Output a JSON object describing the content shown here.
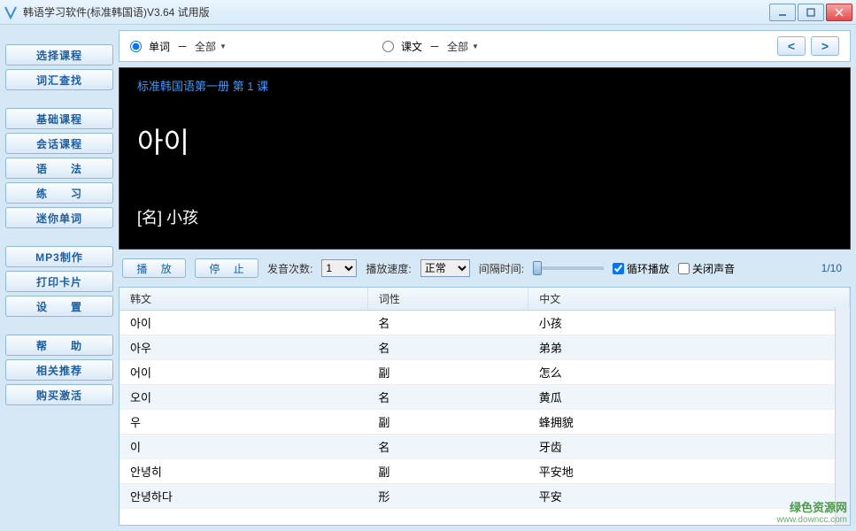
{
  "window": {
    "title": "韩语学习软件(标准韩国语)V3.64 试用版"
  },
  "sidebar": {
    "groups": [
      {
        "items": [
          "选择课程",
          "词汇查找"
        ]
      },
      {
        "items": [
          "基础课程",
          "会话课程",
          "语　　法",
          "练　　习",
          "迷你单词"
        ]
      },
      {
        "items": [
          "MP3制作",
          "打印卡片",
          "设　　置"
        ]
      },
      {
        "items": [
          "帮　　助",
          "相关推荐",
          "购买激活"
        ]
      }
    ]
  },
  "filter": {
    "word_radio": "单词",
    "lesson_radio": "课文",
    "all_dropdown": "全部",
    "dash": "－"
  },
  "blackboard": {
    "lesson": "标准韩国语第一册 第 1 课",
    "word": "아이",
    "meaning": "[名]  小孩"
  },
  "controls": {
    "play": "播 放",
    "stop": "停 止",
    "count_label": "发音次数:",
    "count_value": "1",
    "speed_label": "播放速度:",
    "speed_value": "正常",
    "interval_label": "间隔时间:",
    "loop": "循环播放",
    "mute": "关闭声音",
    "page": "1/10"
  },
  "table": {
    "headers": {
      "korean": "韩文",
      "pos": "词性",
      "chinese": "中文"
    },
    "rows": [
      {
        "k": "아이",
        "p": "名",
        "c": "小孩"
      },
      {
        "k": "아우",
        "p": "名",
        "c": "弟弟"
      },
      {
        "k": "어이",
        "p": "副",
        "c": "怎么"
      },
      {
        "k": "오이",
        "p": "名",
        "c": "黄瓜"
      },
      {
        "k": "우",
        "p": "副",
        "c": "蜂拥貌"
      },
      {
        "k": "이",
        "p": "名",
        "c": "牙齿"
      },
      {
        "k": "안녕히",
        "p": "副",
        "c": "平安地"
      },
      {
        "k": "안녕하다",
        "p": "形",
        "c": "平安"
      }
    ]
  },
  "watermark": {
    "line1": "绿色资源网",
    "line2": "www.downcc.com"
  }
}
